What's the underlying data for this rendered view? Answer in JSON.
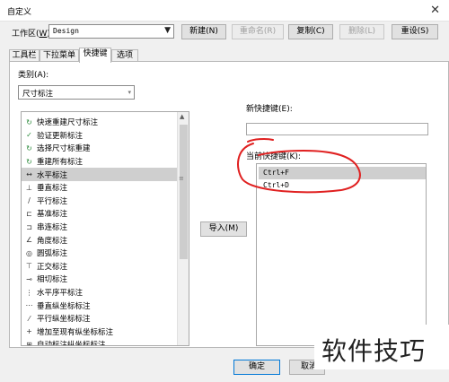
{
  "window": {
    "title": "自定义"
  },
  "workspace": {
    "label": "工作区(",
    "mnemonic": "W",
    "label_end": "):",
    "value": "Design"
  },
  "toolbar": {
    "new": "新建(N)",
    "rename": "重命名(R)",
    "copy": "复制(C)",
    "delete": "删除(L)",
    "reset": "重设(S)"
  },
  "tabs": [
    "工具栏",
    "下拉菜单",
    "快捷键",
    "选项"
  ],
  "active_tab": "快捷键",
  "category": {
    "label": "类别(A):",
    "value": "尺寸标注"
  },
  "commands": [
    "快速重建尺寸标注",
    "验证更新标注",
    "选择尺寸标重建",
    "重建所有标注",
    "水平标注",
    "垂直标注",
    "平行标注",
    "基准标注",
    "串连标注",
    "角度标注",
    "圆弧标注",
    "正交标注",
    "相切标注",
    "水平序平标注",
    "垂直纵坐标标注",
    "平行纵坐标标注",
    "增加至现有纵坐标标注",
    "自动标注纵坐标标注"
  ],
  "selected_command_index": 4,
  "new_shortcut": {
    "label": "新快捷键(E):",
    "value": ""
  },
  "current_shortcut": {
    "label": "当前快捷键(K):",
    "items": [
      "Ctrl+F",
      "Ctrl+D"
    ],
    "selected_index": 0
  },
  "import_button": "导入(M)",
  "ok_button": "确定",
  "cancel_button": "取消",
  "watermark": "软件技巧",
  "colors": {
    "annotation": "#e02020",
    "selection": "#cfcfcf"
  }
}
